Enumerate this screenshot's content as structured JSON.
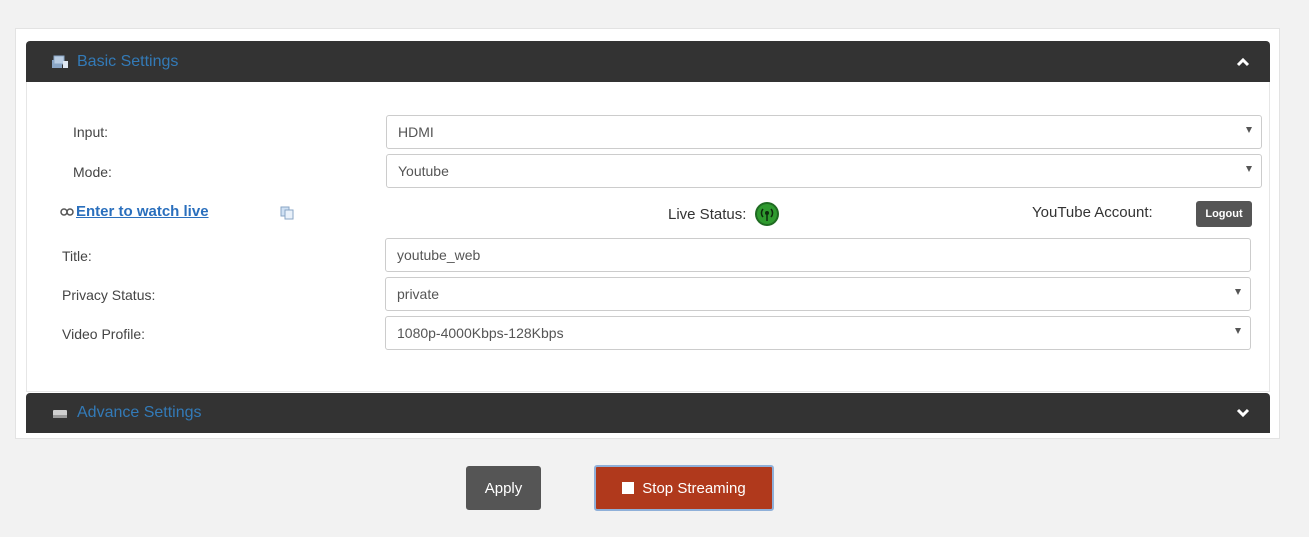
{
  "basic_settings": {
    "title": "Basic Settings",
    "collapse_icon": "chevron-up-icon"
  },
  "form": {
    "input": {
      "label": "Input:",
      "value": "HDMI"
    },
    "mode": {
      "label": "Mode:",
      "value": "Youtube"
    },
    "title": {
      "label": "Title:",
      "value": "youtube_web"
    },
    "privacy": {
      "label": "Privacy Status:",
      "value": "private"
    },
    "video_profile": {
      "label": "Video Profile:",
      "value": "1080p-4000Kbps-128Kbps"
    }
  },
  "live": {
    "watch_link": "Enter to watch live",
    "status_label": "Live Status:",
    "status_color": "#3ea33e",
    "account_label": "YouTube Account:",
    "logout_label": "Logout"
  },
  "advance_settings": {
    "title": "Advance Settings",
    "expand_icon": "chevron-down-icon"
  },
  "actions": {
    "apply_label": "Apply",
    "stop_label": "Stop Streaming"
  },
  "colors": {
    "header_bg": "#333333",
    "header_title": "#337ab7",
    "stop_button": "#b0391c",
    "apply_button": "#555555"
  }
}
